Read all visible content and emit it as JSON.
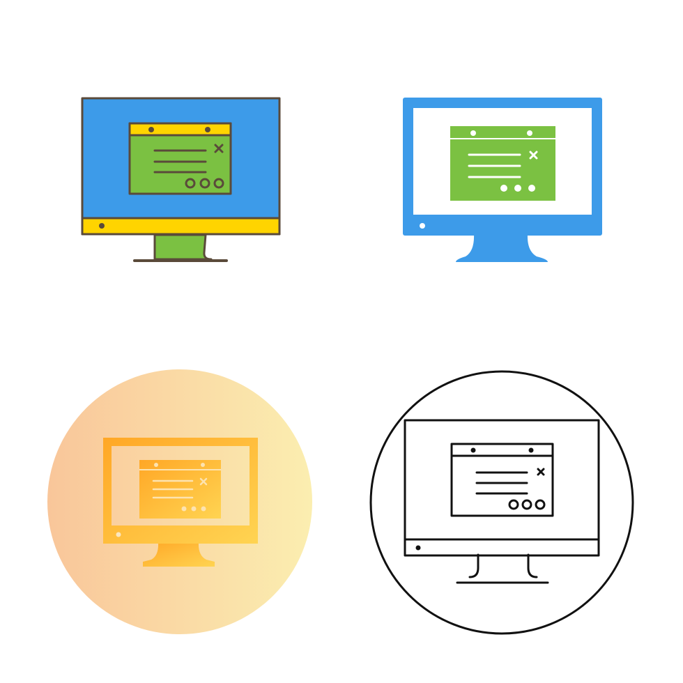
{
  "icons": [
    {
      "name": "monitor-popup-icon",
      "style": "filled-outline",
      "colors": {
        "outline": "#5a4a3a",
        "screen": "#3d9be9",
        "bezel": "#ffd400",
        "window_bar": "#ffd400",
        "window_body": "#7bc142",
        "stand": "#7bc142"
      }
    },
    {
      "name": "monitor-popup-icon",
      "style": "flat",
      "colors": {
        "frame": "#3d9be9",
        "screen": "#ffffff",
        "window": "#7bc142",
        "detail": "#ffffff"
      }
    },
    {
      "name": "monitor-popup-icon",
      "style": "gradient-circle",
      "colors": {
        "circle_from": "#f9c69a",
        "circle_to": "#fbeeb0",
        "icon_from": "#ffa726",
        "icon_to": "#ffd452"
      }
    },
    {
      "name": "monitor-popup-icon",
      "style": "line-circle",
      "colors": {
        "stroke": "#111111",
        "fill": "#ffffff"
      }
    }
  ]
}
